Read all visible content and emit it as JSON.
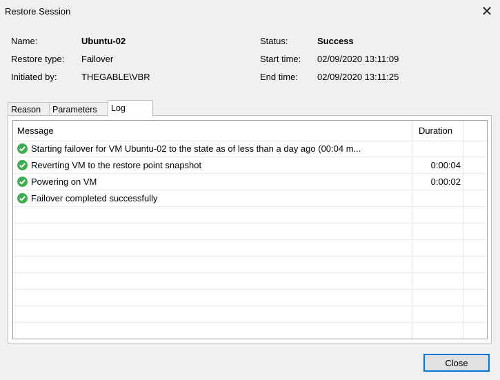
{
  "window": {
    "title": "Restore Session"
  },
  "info": {
    "name_label": "Name:",
    "name_value": "Ubuntu-02",
    "restore_type_label": "Restore type:",
    "restore_type_value": "Failover",
    "initiated_by_label": "Initiated by:",
    "initiated_by_value": "THEGABLE\\VBR",
    "status_label": "Status:",
    "status_value": "Success",
    "start_time_label": "Start time:",
    "start_time_value": "02/09/2020 13:11:09",
    "end_time_label": "End time:",
    "end_time_value": "02/09/2020 13:11:25"
  },
  "tabs": [
    {
      "label": "Reason"
    },
    {
      "label": "Parameters"
    },
    {
      "label": "Log",
      "active": true
    }
  ],
  "log": {
    "columns": {
      "message": "Message",
      "duration": "Duration"
    },
    "rows": [
      {
        "status_icon": "success-check-icon",
        "message": "Starting failover for VM Ubuntu-02 to the state as of less than a day ago (00:04 m...",
        "duration": ""
      },
      {
        "status_icon": "success-check-icon",
        "message": "Reverting VM to the restore point snapshot",
        "duration": "0:00:04"
      },
      {
        "status_icon": "success-check-icon",
        "message": "Powering on VM",
        "duration": "0:00:02"
      },
      {
        "status_icon": "success-check-icon",
        "message": "Failover completed successfully",
        "duration": ""
      }
    ]
  },
  "buttons": {
    "close_label": "Close"
  },
  "colors": {
    "success": "#3dae50",
    "focus_border": "#0078d7"
  }
}
